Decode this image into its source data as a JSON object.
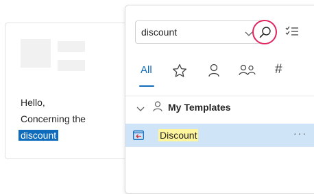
{
  "email": {
    "line1": "Hello,",
    "line2": "Concerning the",
    "selected_word": "discount"
  },
  "search": {
    "value": "discount",
    "placeholder": ""
  },
  "tabs": [
    {
      "label": "All",
      "selected": true
    },
    {
      "icon": "star-icon"
    },
    {
      "icon": "person-icon"
    },
    {
      "icon": "people-icon"
    },
    {
      "label": "#"
    }
  ],
  "section": {
    "label": "My Templates",
    "expanded": true
  },
  "templates": [
    {
      "name": "Discount",
      "selected": true,
      "more_label": "···"
    }
  ],
  "colors": {
    "accent": "#0f6cbd",
    "search_highlight_ring": "#e0245e",
    "row_selected": "#cfe4f7",
    "match_highlight": "#fff59d"
  }
}
